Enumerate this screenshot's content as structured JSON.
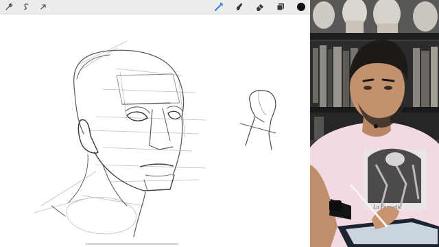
{
  "app": {
    "left_tools": [
      {
        "name": "wrench-icon"
      },
      {
        "name": "adjustments-icon"
      },
      {
        "name": "selection-arrow-icon"
      }
    ],
    "right_tools": [
      {
        "name": "brush-icon"
      },
      {
        "name": "smudge-icon"
      },
      {
        "name": "eraser-icon"
      },
      {
        "name": "layers-icon"
      },
      {
        "name": "color-swatch"
      }
    ],
    "active_tool": "brush",
    "active_color": "#111111",
    "accent_color": "#2f7de1"
  },
  "webcam": {
    "shirt_print": "La Famiglia"
  }
}
